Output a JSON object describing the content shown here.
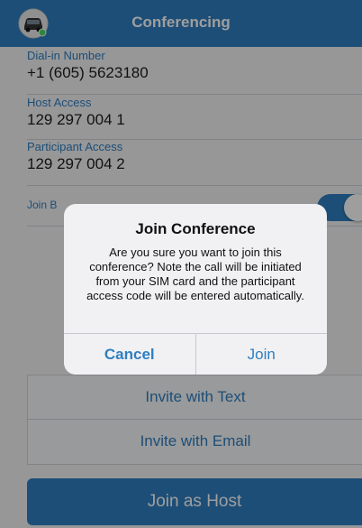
{
  "header": {
    "title": "Conferencing",
    "icon": "car-icon"
  },
  "fields": [
    {
      "label": "Dial-in Number",
      "value": "+1 (605) 5623180"
    },
    {
      "label": "Host Access",
      "value": "129 297 004 1"
    },
    {
      "label": "Participant Access",
      "value": "129 297 004 2"
    }
  ],
  "toggle_row": {
    "label": "Join B",
    "on": true
  },
  "invite": {
    "text_label": "Invite with Text",
    "email_label": "Invite with Email"
  },
  "host_button": {
    "label": "Join as Host"
  },
  "dialog": {
    "title": "Join Conference",
    "message": "Are you sure you want to join this conference? Note the call will be initiated from your SIM card and the participant access code will be entered automatically.",
    "cancel_label": "Cancel",
    "join_label": "Join"
  },
  "colors": {
    "accent": "#2f7fc0",
    "background": "#f4f4f6"
  }
}
